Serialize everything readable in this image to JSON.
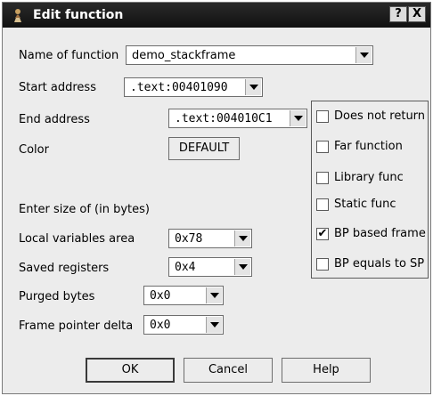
{
  "window": {
    "title": "Edit function",
    "help_button": "?",
    "close_button": "X"
  },
  "fields": {
    "name": {
      "label": "Name of function",
      "value": "demo_stackframe"
    },
    "start": {
      "label": "Start address",
      "value": ".text:00401090"
    },
    "end": {
      "label": "End address",
      "value": ".text:004010C1"
    },
    "color": {
      "label": "Color",
      "value": "DEFAULT"
    }
  },
  "size_section": {
    "label": "Enter size of (in bytes)"
  },
  "sizes": {
    "local": {
      "label": "Local variables area",
      "value": "0x78"
    },
    "saved": {
      "label": "Saved registers",
      "value": "0x4"
    },
    "purged": {
      "label": "Purged bytes",
      "value": "0x0"
    },
    "fpd": {
      "label": "Frame pointer delta",
      "value": "0x0"
    }
  },
  "flags": [
    {
      "label": "Does not return",
      "checked": false
    },
    {
      "label": "Far function",
      "checked": false
    },
    {
      "label": "Library func",
      "checked": false
    },
    {
      "label": "Static func",
      "checked": false
    },
    {
      "label": "BP based frame",
      "checked": true
    },
    {
      "label": "BP equals to SP",
      "checked": false
    }
  ],
  "buttons": {
    "ok": "OK",
    "cancel": "Cancel",
    "help": "Help"
  },
  "check_mark": "✔"
}
